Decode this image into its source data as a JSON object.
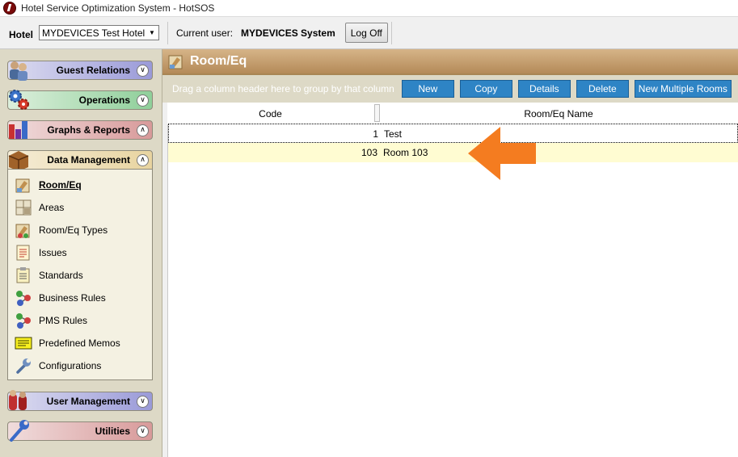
{
  "window": {
    "title": "Hotel Service Optimization System - HotSOS"
  },
  "toolbar": {
    "hotel_label": "Hotel",
    "hotel_value": "MYDEVICES Test Hotel",
    "current_user_label": "Current user:",
    "current_user_name": "MYDEVICES System",
    "logoff_label": "Log Off"
  },
  "sidebar": {
    "groups": {
      "guest_relations": "Guest Relations",
      "operations": "Operations",
      "graphs_reports": "Graphs & Reports",
      "data_management": "Data Management",
      "user_management": "User Management",
      "utilities": "Utilities"
    },
    "dm_items": [
      {
        "label": "Room/Eq",
        "icon": "room-eq-icon"
      },
      {
        "label": "Areas",
        "icon": "areas-icon"
      },
      {
        "label": "Room/Eq Types",
        "icon": "room-eq-types-icon"
      },
      {
        "label": "Issues",
        "icon": "issues-icon"
      },
      {
        "label": "Standards",
        "icon": "standards-icon"
      },
      {
        "label": "Business Rules",
        "icon": "business-rules-icon"
      },
      {
        "label": "PMS Rules",
        "icon": "pms-rules-icon"
      },
      {
        "label": "Predefined Memos",
        "icon": "predefined-memos-icon"
      },
      {
        "label": "Configurations",
        "icon": "wrench-icon"
      }
    ]
  },
  "main": {
    "title": "Room/Eq",
    "group_hint": "Drag a column header here to group by that column",
    "buttons": {
      "new": "New",
      "copy": "Copy",
      "details": "Details",
      "delete": "Delete",
      "new_multiple": "New Multiple Rooms"
    },
    "columns": {
      "code": "Code",
      "name": "Room/Eq Name"
    },
    "rows": [
      {
        "code": "1",
        "name": "Test"
      },
      {
        "code": "103",
        "name": "Room 103"
      }
    ]
  },
  "colors": {
    "accent_button": "#2e84c5",
    "header_brown": "#b48a58",
    "highlight_row": "#fffcd2",
    "annotation_arrow": "#f47c20"
  }
}
